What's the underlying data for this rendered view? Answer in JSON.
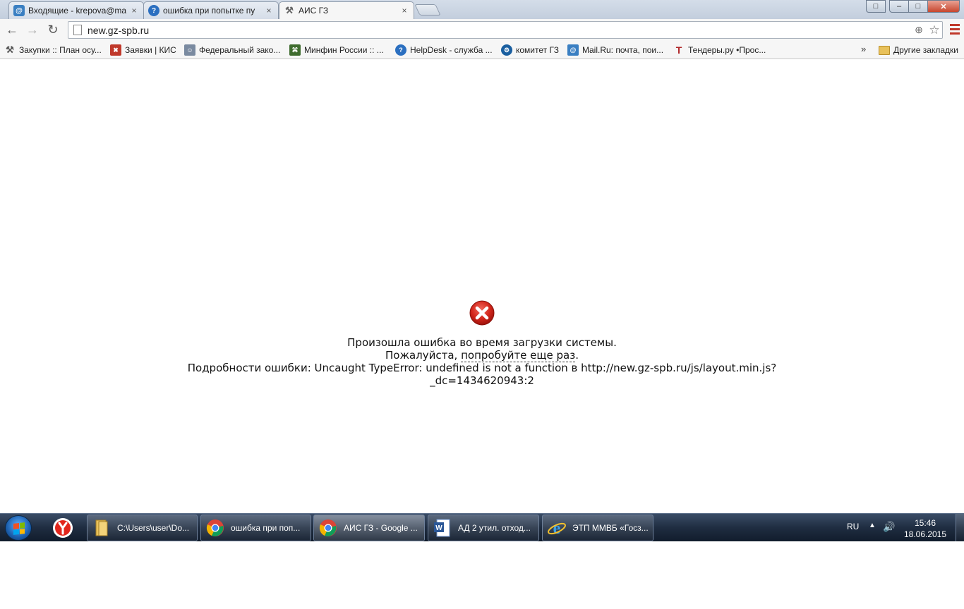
{
  "tabs": [
    {
      "title": "Входящие - krepova@ma",
      "close": "×"
    },
    {
      "title": "ошибка при попытке пу",
      "close": "×"
    },
    {
      "title": "АИС ГЗ",
      "close": "×"
    }
  ],
  "window_controls": {
    "user": "□",
    "minimize": "‒",
    "maximize": "□",
    "close": "✕"
  },
  "toolbar": {
    "back": "←",
    "forward": "→",
    "reload": "↻",
    "url": "new.gz-spb.ru",
    "zoom": "⊕",
    "star": "☆"
  },
  "bookmarks": [
    {
      "label": "Закупки :: План осу..."
    },
    {
      "label": "Заявки | КИС"
    },
    {
      "label": "Федеральный зако..."
    },
    {
      "label": "Минфин России :: ..."
    },
    {
      "label": "HelpDesk - служба ..."
    },
    {
      "label": "комитет ГЗ"
    },
    {
      "label": "Mail.Ru: почта, пои..."
    },
    {
      "label": "Тендеры.ру •Прос..."
    }
  ],
  "bookmarks_more": "»",
  "bookmarks_other": "Другие закладки",
  "error": {
    "line1": "Произошла ошибка во время загрузки системы.",
    "line2_prefix": "Пожалуйста, ",
    "line2_link": "попробуйте еще раз",
    "line2_suffix": ".",
    "line3": "Подробности ошибки: Uncaught TypeError: undefined is not a function в http://new.gz-spb.ru/js/layout.min.js?",
    "line4": "_dc=1434620943:2"
  },
  "taskbar": {
    "tasks": [
      {
        "label": "C:\\Users\\user\\Do..."
      },
      {
        "label": "ошибка при поп..."
      },
      {
        "label": "АИС ГЗ - Google ..."
      },
      {
        "label": "АД 2 утил. отход..."
      },
      {
        "label": "ЭТП ММВБ «Госз..."
      }
    ],
    "lang": "RU",
    "time": "15:46",
    "date": "18.06.2015"
  }
}
